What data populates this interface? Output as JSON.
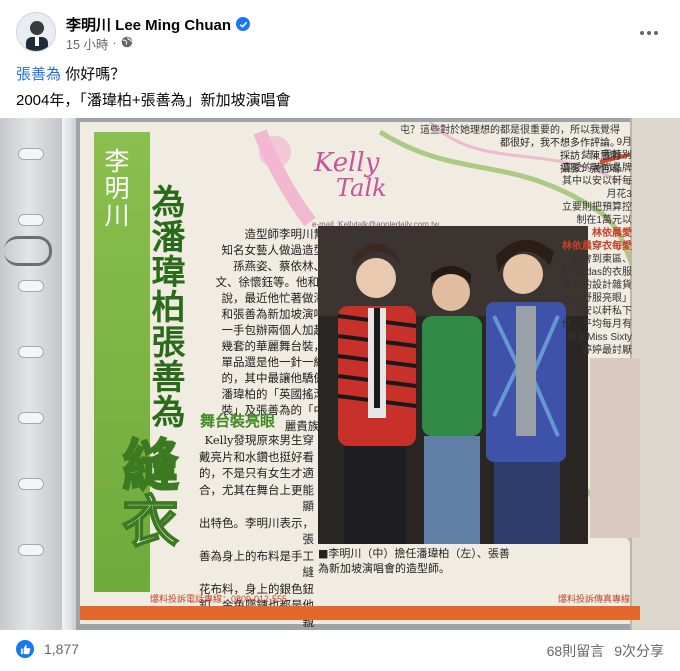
{
  "post": {
    "author": "李明川 Lee Ming Chuan",
    "time": "15 小時",
    "time_separator": "·",
    "mention": "張善為",
    "greeting": "你好嗎？",
    "line2": "2004年，「潘瑋柏+張善為」新加坡演唱會"
  },
  "newspaper": {
    "top_right": [
      "屯？這些對於她理想的都是很重要的，所以我覺得",
      "都很好，我不想多作評論。",
      "採訪：陳慧明",
      "攝影：張哲鳴"
    ],
    "title_small": "李明川",
    "title_mid": "為潘瑋柏張善為",
    "title_big": "縫衣",
    "logo_line1": "Kelly",
    "logo_line2": "Talk",
    "email": "e-mail :Kellytalk@appledaily.com.tw",
    "article": "造型師李明川幫不少\n知名女藝人做過造型，如\n孫燕姿、蔡依林、何嘉\n文、徐懷鈺等。他和Kelly\n說，最近他忙著做潘瑋柏\n和張善為新加坡演唱會，\n一手包辦兩個人加起來十\n幾套的華麗舞台裝，許多\n單品還是他一針一線縫製\n的，其中最讓他驕傲的是\n潘瑋柏的「英國搖滾龐克\n裝」及張善為的「中國華\n麗貴族裝」。",
    "subhead": "舞台裝亮眼",
    "article2": "Kelly發現原來男生穿\n戴亮片和水鑽也挺好看\n的，不是只有女生才適\n合，尤其在舞台上更能顯\n出特色。李明川表示，張\n善為身上的布料是手工縫\n花布料，身上的銀色鈕\n釦、金色墜鍊也都是他親\n手縫的，為此不眠不休加\n工，黑眼圈加大三圈！",
    "caption": "■李明川（中）擔任潘瑋柏（左）、張善\n為新加坡演唱會的造型師。",
    "tip_left": "爆料投訴電話專線：0809-012-555",
    "tip_right": "爆料投訴傳真專線",
    "side_text": [
      "9月",
      "誌，我特別",
      "喜愛的時尚品牌",
      "其中以安以軒每月花3",
      "立要則把預算控制在1萬元以",
      "林依晨愛",
      "林依晨穿衣每愛",
      "她會到東區、",
      "愛Adidas的衣服",
      "年來的設計雜貨",
      "的「舒服亮眼」",
      "安以軒私下",
      "件，平均每月有",
      "最愛Miss Sixty",
      "婷婷最討厭"
    ]
  },
  "footer": {
    "like_count": "1,877",
    "comments": "68則留言",
    "shares": "9次分享"
  }
}
